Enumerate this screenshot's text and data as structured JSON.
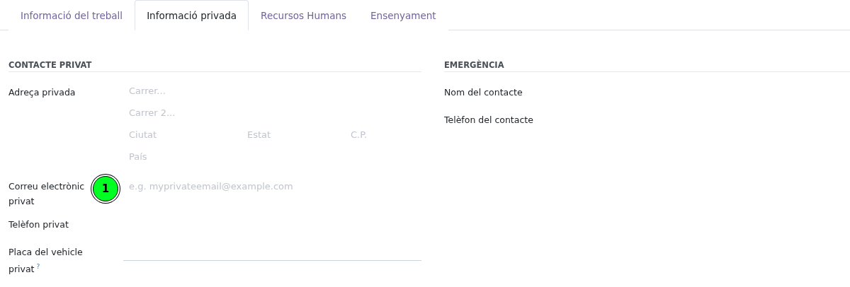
{
  "tabs": [
    {
      "label": "Informació del treball",
      "selected": false
    },
    {
      "label": "Informació privada",
      "selected": true
    },
    {
      "label": "Recursos Humans",
      "selected": false
    },
    {
      "label": "Ensenyament",
      "selected": false
    }
  ],
  "private_contact": {
    "title": "CONTACTE PRIVAT",
    "address": {
      "label": "Adreça privada",
      "street_placeholder": "Carrer...",
      "street2_placeholder": "Carrer 2...",
      "city_placeholder": "Ciutat",
      "state_placeholder": "Estat",
      "zip_placeholder": "C.P.",
      "country_placeholder": "País"
    },
    "email": {
      "label": "Correu electrònic privat",
      "placeholder": "e.g. myprivateemail@example.com",
      "badge": "1"
    },
    "phone": {
      "label": "Telèfon privat"
    },
    "plate": {
      "label": "Placa del vehicle privat",
      "help": "?"
    }
  },
  "emergency": {
    "title": "EMERGÈNCIA",
    "fields": [
      {
        "label": "Nom del contacte"
      },
      {
        "label": "Telèfon del contacte"
      }
    ]
  }
}
